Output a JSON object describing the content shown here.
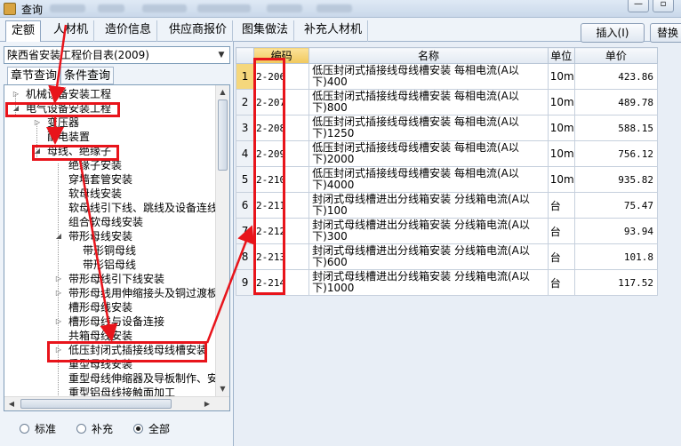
{
  "window": {
    "title": "查询"
  },
  "tabs": [
    "定额",
    "人材机",
    "造价信息",
    "供应商报价",
    "图集做法",
    "补充人材机"
  ],
  "buttons": {
    "insert": "插入(I)",
    "replace": "替换"
  },
  "left": {
    "library": "陕西省安装工程价目表(2009)",
    "subtabs": [
      "章节查询",
      "条件查询"
    ],
    "tree": [
      {
        "label": "机械设备安装工程",
        "toggle": "▷"
      },
      {
        "label": "电气设备安装工程",
        "toggle": "◢"
      },
      {
        "label": "变压器",
        "toggle": "▷"
      },
      {
        "label": "配电装置",
        "toggle": ""
      },
      {
        "label": "母线、绝缘子",
        "toggle": "◢"
      },
      {
        "label": "绝缘子安装",
        "toggle": ""
      },
      {
        "label": "穿墙套管安装",
        "toggle": ""
      },
      {
        "label": "软母线安装",
        "toggle": ""
      },
      {
        "label": "软母线引下线、跳线及设备连线",
        "toggle": ""
      },
      {
        "label": "组合软母线安装",
        "toggle": ""
      },
      {
        "label": "带形母线安装",
        "toggle": "◢"
      },
      {
        "label": "带形铜母线",
        "toggle": ""
      },
      {
        "label": "带形铝母线",
        "toggle": ""
      },
      {
        "label": "带形母线引下线安装",
        "toggle": "▷"
      },
      {
        "label": "带形母线用伸缩接头及铜过渡板",
        "toggle": "▷"
      },
      {
        "label": "槽形母线安装",
        "toggle": ""
      },
      {
        "label": "槽形母线与设备连接",
        "toggle": "▷"
      },
      {
        "label": "共箱母线安装",
        "toggle": ""
      },
      {
        "label": "低压封闭式插接线母线槽安装",
        "toggle": "▷"
      },
      {
        "label": "重型母线安装",
        "toggle": ""
      },
      {
        "label": "重型母线伸缩器及导板制作、安",
        "toggle": ""
      },
      {
        "label": "重型铝母线接触面加工",
        "toggle": ""
      }
    ],
    "radios": [
      {
        "label": "标准",
        "checked": false
      },
      {
        "label": "补充",
        "checked": false
      },
      {
        "label": "全部",
        "checked": true
      }
    ]
  },
  "table": {
    "headers": [
      "编码",
      "名称",
      "单位",
      "单价"
    ],
    "rows": [
      {
        "no": "1",
        "code": "2-206",
        "name": "低压封闭式插接线母线槽安装  每相电流(A以下)400",
        "unit": "10m",
        "price": "423.86"
      },
      {
        "no": "2",
        "code": "2-207",
        "name": "低压封闭式插接线母线槽安装  每相电流(A以下)800",
        "unit": "10m",
        "price": "489.78"
      },
      {
        "no": "3",
        "code": "2-208",
        "name": "低压封闭式插接线母线槽安装  每相电流(A以下)1250",
        "unit": "10m",
        "price": "588.15"
      },
      {
        "no": "4",
        "code": "2-209",
        "name": "低压封闭式插接线母线槽安装  每相电流(A以下)2000",
        "unit": "10m",
        "price": "756.12"
      },
      {
        "no": "5",
        "code": "2-210",
        "name": "低压封闭式插接线母线槽安装  每相电流(A以下)4000",
        "unit": "10m",
        "price": "935.82"
      },
      {
        "no": "6",
        "code": "2-211",
        "name": "封闭式母线槽进出分线箱安装  分线箱电流(A以下)100",
        "unit": "台",
        "price": "75.47"
      },
      {
        "no": "7",
        "code": "2-212",
        "name": "封闭式母线槽进出分线箱安装  分线箱电流(A以下)300",
        "unit": "台",
        "price": "93.94"
      },
      {
        "no": "8",
        "code": "2-213",
        "name": "封闭式母线槽进出分线箱安装  分线箱电流(A以下)600",
        "unit": "台",
        "price": "101.8"
      },
      {
        "no": "9",
        "code": "2-214",
        "name": "封闭式母线槽进出分线箱安装  分线箱电流(A以下)1000",
        "unit": "台",
        "price": "117.52"
      }
    ]
  },
  "colors": {
    "annotation": "#e8141b",
    "selected_row": "#f5d77c"
  }
}
